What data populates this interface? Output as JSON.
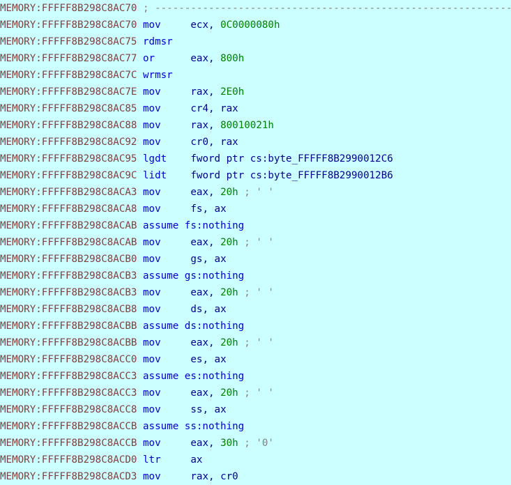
{
  "view": {
    "name": "ida-disassembly-view",
    "segment": "MEMORY",
    "background_color": "#ccffff",
    "colors": {
      "address": "#804040",
      "mnemonic": "#0000d0",
      "register": "#00008b",
      "number": "#008000",
      "comment": "#808080",
      "directive": "#0000d0"
    },
    "line_count": 27
  },
  "lines": [
    {
      "address": "MEMORY:FFFFF8B298C8AC70",
      "kind": "comment",
      "comment": "; ----------------------------------------------------------------------------",
      "mnemonic": "",
      "operands": "",
      "trailing_comment": ""
    },
    {
      "address": "MEMORY:FFFFF8B298C8AC70",
      "kind": "instruction",
      "mnemonic": "mov",
      "operands": "ecx, 0C0000080h",
      "op_reg": "ecx, ",
      "op_num": "0C0000080h",
      "trailing_comment": ""
    },
    {
      "address": "MEMORY:FFFFF8B298C8AC75",
      "kind": "instruction",
      "mnemonic": "rdmsr",
      "operands": "",
      "op_reg": "",
      "op_num": "",
      "trailing_comment": ""
    },
    {
      "address": "MEMORY:FFFFF8B298C8AC77",
      "kind": "instruction",
      "mnemonic": "or",
      "operands": "eax, 800h",
      "op_reg": "eax, ",
      "op_num": "800h",
      "trailing_comment": ""
    },
    {
      "address": "MEMORY:FFFFF8B298C8AC7C",
      "kind": "instruction",
      "mnemonic": "wrmsr",
      "operands": "",
      "op_reg": "",
      "op_num": "",
      "trailing_comment": ""
    },
    {
      "address": "MEMORY:FFFFF8B298C8AC7E",
      "kind": "instruction",
      "mnemonic": "mov",
      "operands": "rax, 2E0h",
      "op_reg": "rax, ",
      "op_num": "2E0h",
      "trailing_comment": ""
    },
    {
      "address": "MEMORY:FFFFF8B298C8AC85",
      "kind": "instruction",
      "mnemonic": "mov",
      "operands": "cr4, rax",
      "op_reg": "cr4, rax",
      "op_num": "",
      "trailing_comment": ""
    },
    {
      "address": "MEMORY:FFFFF8B298C8AC88",
      "kind": "instruction",
      "mnemonic": "mov",
      "operands": "rax, 80010021h",
      "op_reg": "rax, ",
      "op_num": "80010021h",
      "trailing_comment": ""
    },
    {
      "address": "MEMORY:FFFFF8B298C8AC92",
      "kind": "instruction",
      "mnemonic": "mov",
      "operands": "cr0, rax",
      "op_reg": "cr0, rax",
      "op_num": "",
      "trailing_comment": ""
    },
    {
      "address": "MEMORY:FFFFF8B298C8AC95",
      "kind": "instruction",
      "mnemonic": "lgdt",
      "operands": "fword ptr cs:byte_FFFFF8B2990012C6",
      "op_reg": "fword ptr cs:byte_FFFFF8B2990012C6",
      "op_num": "",
      "trailing_comment": ""
    },
    {
      "address": "MEMORY:FFFFF8B298C8AC9C",
      "kind": "instruction",
      "mnemonic": "lidt",
      "operands": "fword ptr cs:byte_FFFFF8B2990012B6",
      "op_reg": "fword ptr cs:byte_FFFFF8B2990012B6",
      "op_num": "",
      "trailing_comment": ""
    },
    {
      "address": "MEMORY:FFFFF8B298C8ACA3",
      "kind": "instruction",
      "mnemonic": "mov",
      "operands": "eax, 20h",
      "op_reg": "eax, ",
      "op_num": "20h",
      "trailing_comment": "; ' '"
    },
    {
      "address": "MEMORY:FFFFF8B298C8ACA8",
      "kind": "instruction",
      "mnemonic": "mov",
      "operands": "fs, ax",
      "op_reg": "fs, ax",
      "op_num": "",
      "trailing_comment": ""
    },
    {
      "address": "MEMORY:FFFFF8B298C8ACAB",
      "kind": "directive",
      "mnemonic": "assume",
      "operands": "fs:nothing",
      "directive_text": "assume fs:nothing",
      "trailing_comment": ""
    },
    {
      "address": "MEMORY:FFFFF8B298C8ACAB",
      "kind": "instruction",
      "mnemonic": "mov",
      "operands": "eax, 20h",
      "op_reg": "eax, ",
      "op_num": "20h",
      "trailing_comment": "; ' '"
    },
    {
      "address": "MEMORY:FFFFF8B298C8ACB0",
      "kind": "instruction",
      "mnemonic": "mov",
      "operands": "gs, ax",
      "op_reg": "gs, ax",
      "op_num": "",
      "trailing_comment": ""
    },
    {
      "address": "MEMORY:FFFFF8B298C8ACB3",
      "kind": "directive",
      "mnemonic": "assume",
      "operands": "gs:nothing",
      "directive_text": "assume gs:nothing",
      "trailing_comment": ""
    },
    {
      "address": "MEMORY:FFFFF8B298C8ACB3",
      "kind": "instruction",
      "mnemonic": "mov",
      "operands": "eax, 20h",
      "op_reg": "eax, ",
      "op_num": "20h",
      "trailing_comment": "; ' '"
    },
    {
      "address": "MEMORY:FFFFF8B298C8ACB8",
      "kind": "instruction",
      "mnemonic": "mov",
      "operands": "ds, ax",
      "op_reg": "ds, ax",
      "op_num": "",
      "trailing_comment": ""
    },
    {
      "address": "MEMORY:FFFFF8B298C8ACBB",
      "kind": "directive",
      "mnemonic": "assume",
      "operands": "ds:nothing",
      "directive_text": "assume ds:nothing",
      "trailing_comment": ""
    },
    {
      "address": "MEMORY:FFFFF8B298C8ACBB",
      "kind": "instruction",
      "mnemonic": "mov",
      "operands": "eax, 20h",
      "op_reg": "eax, ",
      "op_num": "20h",
      "trailing_comment": "; ' '"
    },
    {
      "address": "MEMORY:FFFFF8B298C8ACC0",
      "kind": "instruction",
      "mnemonic": "mov",
      "operands": "es, ax",
      "op_reg": "es, ax",
      "op_num": "",
      "trailing_comment": ""
    },
    {
      "address": "MEMORY:FFFFF8B298C8ACC3",
      "kind": "directive",
      "mnemonic": "assume",
      "operands": "es:nothing",
      "directive_text": "assume es:nothing",
      "trailing_comment": ""
    },
    {
      "address": "MEMORY:FFFFF8B298C8ACC3",
      "kind": "instruction",
      "mnemonic": "mov",
      "operands": "eax, 20h",
      "op_reg": "eax, ",
      "op_num": "20h",
      "trailing_comment": "; ' '"
    },
    {
      "address": "MEMORY:FFFFF8B298C8ACC8",
      "kind": "instruction",
      "mnemonic": "mov",
      "operands": "ss, ax",
      "op_reg": "ss, ax",
      "op_num": "",
      "trailing_comment": ""
    },
    {
      "address": "MEMORY:FFFFF8B298C8ACCB",
      "kind": "directive",
      "mnemonic": "assume",
      "operands": "ss:nothing",
      "directive_text": "assume ss:nothing",
      "trailing_comment": ""
    },
    {
      "address": "MEMORY:FFFFF8B298C8ACCB",
      "kind": "instruction",
      "mnemonic": "mov",
      "operands": "eax, 30h",
      "op_reg": "eax, ",
      "op_num": "30h",
      "trailing_comment": "; '0'"
    },
    {
      "address": "MEMORY:FFFFF8B298C8ACD0",
      "kind": "instruction",
      "mnemonic": "ltr",
      "operands": "ax",
      "op_reg": "ax",
      "op_num": "",
      "trailing_comment": ""
    },
    {
      "address": "MEMORY:FFFFF8B298C8ACD3",
      "kind": "instruction",
      "mnemonic": "mov",
      "operands": "rax, cr0",
      "op_reg": "rax, cr0",
      "op_num": "",
      "trailing_comment": ""
    }
  ]
}
